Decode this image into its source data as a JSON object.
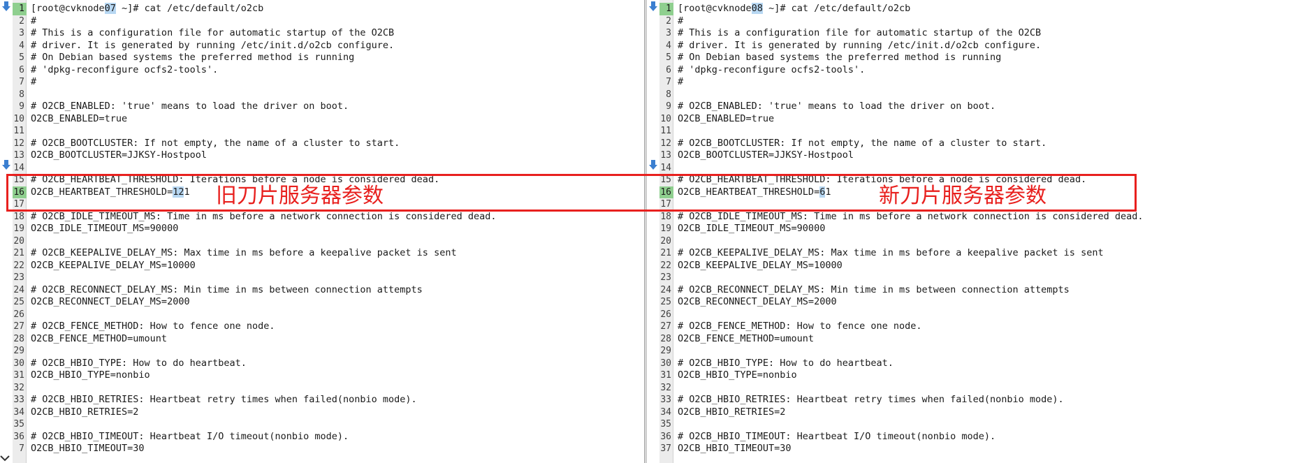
{
  "left": {
    "lines": [
      {
        "n": "1",
        "pre": "[root@cvknode",
        "hl": "07",
        "post": " ~]# cat /etc/default/o2cb"
      },
      {
        "n": "2",
        "text": "#"
      },
      {
        "n": "3",
        "text": "# This is a configuration file for automatic startup of the O2CB"
      },
      {
        "n": "4",
        "text": "# driver.  It is generated by running /etc/init.d/o2cb configure."
      },
      {
        "n": "5",
        "text": "# On Debian based systems the preferred method is running"
      },
      {
        "n": "6",
        "text": "# 'dpkg-reconfigure ocfs2-tools'."
      },
      {
        "n": "7",
        "text": "#"
      },
      {
        "n": "8",
        "text": ""
      },
      {
        "n": "9",
        "text": "# O2CB_ENABLED: 'true' means to load the driver on boot."
      },
      {
        "n": "10",
        "text": "O2CB_ENABLED=true"
      },
      {
        "n": "11",
        "text": ""
      },
      {
        "n": "12",
        "text": "# O2CB_BOOTCLUSTER: If not empty, the name of a cluster to start."
      },
      {
        "n": "13",
        "text": "O2CB_BOOTCLUSTER=JJKSY-Hostpool"
      },
      {
        "n": "14",
        "text": ""
      },
      {
        "n": "15",
        "text": "# O2CB_HEARTBEAT_THRESHOLD: Iterations before a node is considered dead."
      },
      {
        "n": "16",
        "pre": "O2CB_HEARTBEAT_THRESHOLD=",
        "hl": "12",
        "post": "1"
      },
      {
        "n": "17",
        "text": ""
      },
      {
        "n": "18",
        "text": "# O2CB_IDLE_TIMEOUT_MS: Time in ms before a network connection is considered dead."
      },
      {
        "n": "19",
        "text": "O2CB_IDLE_TIMEOUT_MS=90000"
      },
      {
        "n": "20",
        "text": ""
      },
      {
        "n": "21",
        "text": "# O2CB_KEEPALIVE_DELAY_MS: Max time in ms before a keepalive packet is sent"
      },
      {
        "n": "22",
        "text": "O2CB_KEEPALIVE_DELAY_MS=10000"
      },
      {
        "n": "23",
        "text": ""
      },
      {
        "n": "24",
        "text": "# O2CB_RECONNECT_DELAY_MS: Min time in ms between connection attempts"
      },
      {
        "n": "25",
        "text": "O2CB_RECONNECT_DELAY_MS=2000"
      },
      {
        "n": "26",
        "text": ""
      },
      {
        "n": "27",
        "text": "# O2CB_FENCE_METHOD: How to fence one node."
      },
      {
        "n": "28",
        "text": "O2CB_FENCE_METHOD=umount"
      },
      {
        "n": "29",
        "text": ""
      },
      {
        "n": "30",
        "text": "# O2CB_HBIO_TYPE: How to do heartbeat."
      },
      {
        "n": "31",
        "text": "O2CB_HBIO_TYPE=nonbio"
      },
      {
        "n": "32",
        "text": ""
      },
      {
        "n": "33",
        "text": "# O2CB_HBIO_RETRIES: Heartbeat retry times when failed(nonbio mode)."
      },
      {
        "n": "34",
        "text": "O2CB_HBIO_RETRIES=2"
      },
      {
        "n": "35",
        "text": ""
      },
      {
        "n": "36",
        "text": "# O2CB_HBIO_TIMEOUT: Heartbeat I/O timeout(nonbio mode)."
      },
      {
        "n": "7",
        "text": "O2CB_HBIO_TIMEOUT=30"
      }
    ],
    "annotation": "旧刀片服务器参数"
  },
  "right": {
    "lines": [
      {
        "n": "1",
        "pre": "[root@cvknode",
        "hl": "08",
        "post": " ~]# cat /etc/default/o2cb"
      },
      {
        "n": "2",
        "text": "#"
      },
      {
        "n": "3",
        "text": "# This is a configuration file for automatic startup of the O2CB"
      },
      {
        "n": "4",
        "text": "# driver.  It is generated by running /etc/init.d/o2cb configure."
      },
      {
        "n": "5",
        "text": "# On Debian based systems the preferred method is running"
      },
      {
        "n": "6",
        "text": "# 'dpkg-reconfigure ocfs2-tools'."
      },
      {
        "n": "7",
        "text": "#"
      },
      {
        "n": "8",
        "text": ""
      },
      {
        "n": "9",
        "text": "# O2CB_ENABLED: 'true' means to load the driver on boot."
      },
      {
        "n": "10",
        "text": "O2CB_ENABLED=true"
      },
      {
        "n": "11",
        "text": ""
      },
      {
        "n": "12",
        "text": "# O2CB_BOOTCLUSTER: If not empty, the name of a cluster to start."
      },
      {
        "n": "13",
        "text": "O2CB_BOOTCLUSTER=JJKSY-Hostpool"
      },
      {
        "n": "14",
        "text": ""
      },
      {
        "n": "15",
        "text": "# O2CB_HEARTBEAT_THRESHOLD: Iterations before a node is considered dead."
      },
      {
        "n": "16",
        "pre": "O2CB_HEARTBEAT_THRESHOLD=",
        "hl": "6",
        "post": "1"
      },
      {
        "n": "17",
        "text": ""
      },
      {
        "n": "18",
        "text": "# O2CB_IDLE_TIMEOUT_MS: Time in ms before a network connection is considered dead."
      },
      {
        "n": "19",
        "text": "O2CB_IDLE_TIMEOUT_MS=90000"
      },
      {
        "n": "20",
        "text": ""
      },
      {
        "n": "21",
        "text": "# O2CB_KEEPALIVE_DELAY_MS: Max time in ms before a keepalive packet is sent"
      },
      {
        "n": "22",
        "text": "O2CB_KEEPALIVE_DELAY_MS=10000"
      },
      {
        "n": "23",
        "text": ""
      },
      {
        "n": "24",
        "text": "# O2CB_RECONNECT_DELAY_MS: Min time in ms between connection attempts"
      },
      {
        "n": "25",
        "text": "O2CB_RECONNECT_DELAY_MS=2000"
      },
      {
        "n": "26",
        "text": ""
      },
      {
        "n": "27",
        "text": "# O2CB_FENCE_METHOD: How to fence one node."
      },
      {
        "n": "28",
        "text": "O2CB_FENCE_METHOD=umount"
      },
      {
        "n": "29",
        "text": ""
      },
      {
        "n": "30",
        "text": "# O2CB_HBIO_TYPE: How to do heartbeat."
      },
      {
        "n": "31",
        "text": "O2CB_HBIO_TYPE=nonbio"
      },
      {
        "n": "32",
        "text": ""
      },
      {
        "n": "33",
        "text": "# O2CB_HBIO_RETRIES: Heartbeat retry times when failed(nonbio mode)."
      },
      {
        "n": "34",
        "text": "O2CB_HBIO_RETRIES=2"
      },
      {
        "n": "35",
        "text": ""
      },
      {
        "n": "36",
        "text": "# O2CB_HBIO_TIMEOUT: Heartbeat I/O timeout(nonbio mode)."
      },
      {
        "n": "37",
        "text": "O2CB_HBIO_TIMEOUT=30"
      }
    ],
    "annotation": "新刀片服务器参数"
  },
  "colors": {
    "highlight_box": "#e8201e",
    "selection": "#b7d7f2",
    "active_line_number": "#8fcf8f",
    "diff_arrow": "#3b7fd0"
  },
  "icons": {
    "diff_arrow": "down-arrow-icon",
    "collapse": "chevron-down-icon"
  }
}
